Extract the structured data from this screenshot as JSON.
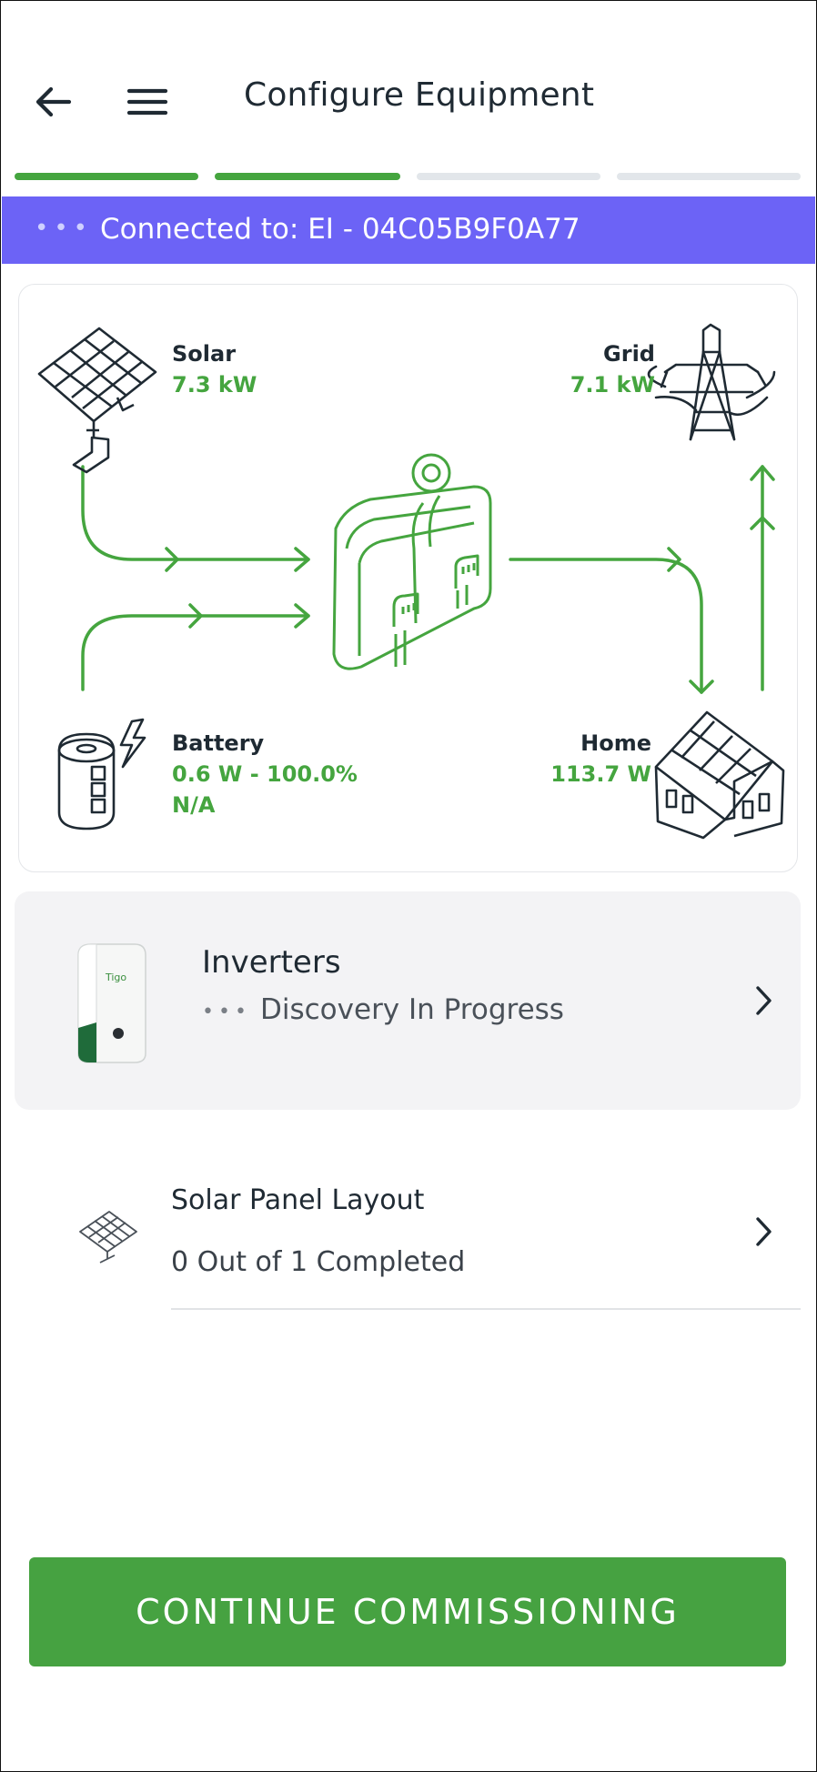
{
  "header": {
    "title": "Configure Equipment"
  },
  "progress": {
    "total_steps": 4,
    "completed_steps": 2
  },
  "connection": {
    "label": "Connected to: EI - 04C05B9F0A77"
  },
  "flow": {
    "solar": {
      "name": "Solar",
      "value": "7.3 kW"
    },
    "grid": {
      "name": "Grid",
      "value": "7.1 kW"
    },
    "battery": {
      "name": "Battery",
      "value": "0.6 W - 100.0%",
      "status": "N/A"
    },
    "home": {
      "name": "Home",
      "value": "113.7 W"
    }
  },
  "inverters": {
    "title": "Inverters",
    "status": "Discovery In Progress"
  },
  "solar_layout": {
    "title": "Solar Panel Layout",
    "progress": "0 Out of 1 Completed"
  },
  "cta": {
    "label": "CONTINUE COMMISSIONING"
  },
  "colors": {
    "accent_green": "#45a53f",
    "banner_purple": "#6c63f6",
    "card_gray": "#f3f3f5"
  }
}
